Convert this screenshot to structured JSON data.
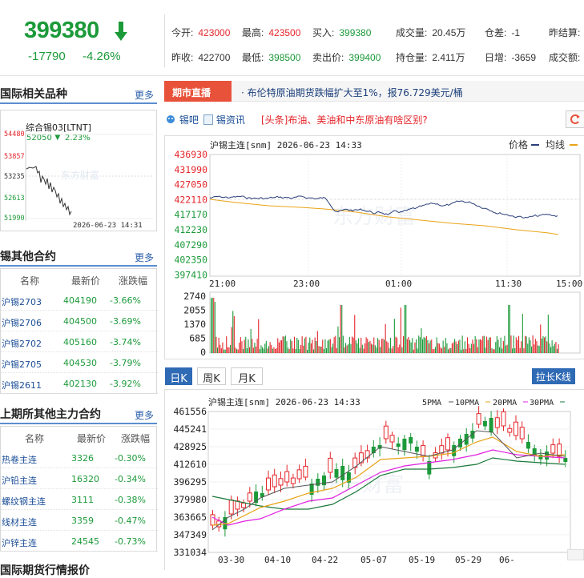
{
  "header": {
    "price": "399380",
    "change": "-17790",
    "change_pct": "-4.26%",
    "quotes_row1": [
      {
        "label": "今开:",
        "value": "423000",
        "color": "red"
      },
      {
        "label": "最高:",
        "value": "423500",
        "color": "red"
      },
      {
        "label": "买入:",
        "value": "399380",
        "color": "grn"
      },
      {
        "label": "成交量:",
        "value": "20.45万",
        "color": "blk"
      },
      {
        "label": "仓差:",
        "value": "-1",
        "color": "blk"
      },
      {
        "label": "昨结算:",
        "value": "",
        "color": "blk"
      }
    ],
    "quotes_row2": [
      {
        "label": "昨收:",
        "value": "422700",
        "color": "blk"
      },
      {
        "label": "最低:",
        "value": "398500",
        "color": "grn"
      },
      {
        "label": "卖出价:",
        "value": "399400",
        "color": "grn"
      },
      {
        "label": "持仓量:",
        "value": "2.411万",
        "color": "blk"
      },
      {
        "label": "日增:",
        "value": "-3659",
        "color": "blk"
      },
      {
        "label": "成交额:",
        "value": "",
        "color": "blk"
      }
    ]
  },
  "intl": {
    "title": "国际相关品种",
    "more": "更多",
    "chart_name": "综合锡03[LTNT]",
    "last": "52050",
    "pct": "2.23%",
    "date": "2026-06-23 14:31",
    "yticks": [
      "54480",
      "53857",
      "53235",
      "52613",
      "51990"
    ],
    "watermark": "东方财富"
  },
  "tin_contracts": {
    "title": "锡其他合约",
    "more": "更多",
    "headers": [
      "名称",
      "最新价",
      "涨跌幅"
    ],
    "rows": [
      {
        "name": "沪锡2703",
        "price": "404190",
        "pct": "-3.66%"
      },
      {
        "name": "沪锡2706",
        "price": "404500",
        "pct": "-3.69%"
      },
      {
        "name": "沪锡2702",
        "price": "405160",
        "pct": "-3.74%"
      },
      {
        "name": "沪锡2705",
        "price": "404530",
        "pct": "-3.79%"
      },
      {
        "name": "沪锡2611",
        "price": "402130",
        "pct": "-3.92%"
      }
    ]
  },
  "shfe_main": {
    "title": "上期所其他主力合约",
    "more": "更多",
    "headers": [
      "名称",
      "最新价",
      "涨跌幅"
    ],
    "rows": [
      {
        "name": "热卷主连",
        "price": "3326",
        "pct": "-0.30%"
      },
      {
        "name": "沪铅主连",
        "price": "16320",
        "pct": "-0.34%"
      },
      {
        "name": "螺纹钢主连",
        "price": "3111",
        "pct": "-0.38%"
      },
      {
        "name": "线材主连",
        "price": "3359",
        "pct": "-0.47%"
      },
      {
        "name": "沪锌主连",
        "price": "24545",
        "pct": "-0.73%"
      }
    ]
  },
  "bottom_section": {
    "title": "国际期货行情报价"
  },
  "news": {
    "label": "期市直播",
    "text": "· 布伦特原油期货跌幅扩大至1%，报76.729美元/桶"
  },
  "links": {
    "forum": "锡吧",
    "info": "锡资讯",
    "headline": "[头条]布油、美油和中东原油有啥区别?"
  },
  "intraday": {
    "title": "沪锡主连[snm] 2026-06-23 14:33",
    "legend_price": "价格",
    "legend_avg": "均线",
    "yticks": [
      "436930",
      "431990",
      "427050",
      "422110",
      "417170",
      "412230",
      "407290",
      "402350",
      "397410"
    ],
    "xticks": [
      "21:00",
      "23:00",
      "01:00",
      "11:30",
      "15:00"
    ],
    "vol_ticks": [
      "2740",
      "2055",
      "1370",
      "685",
      "0"
    ],
    "watermark": "东方财富"
  },
  "kline": {
    "tabs": [
      "日K",
      "周K",
      "月K"
    ],
    "stretch": "拉长K线",
    "title": "沪锡主连[snm] 2026-06-23 14:33",
    "ma_labels": [
      "5PMA",
      "10PMA",
      "20PMA",
      "30PMA"
    ],
    "ma_colors": [
      "#555555",
      "#e8a317",
      "#e020e0",
      "#1a7a3a"
    ],
    "yticks": [
      "461556",
      "445241",
      "428925",
      "412610",
      "396295",
      "379980",
      "363665",
      "347349",
      "331034"
    ],
    "xticks": [
      "03-30",
      "04-10",
      "04-22",
      "05-07",
      "05-19",
      "05-29",
      "06-"
    ],
    "watermark": "东方财富"
  },
  "colors": {
    "up": "#e4252a",
    "down": "#1c9a3a",
    "accent": "#2f6ab5"
  }
}
